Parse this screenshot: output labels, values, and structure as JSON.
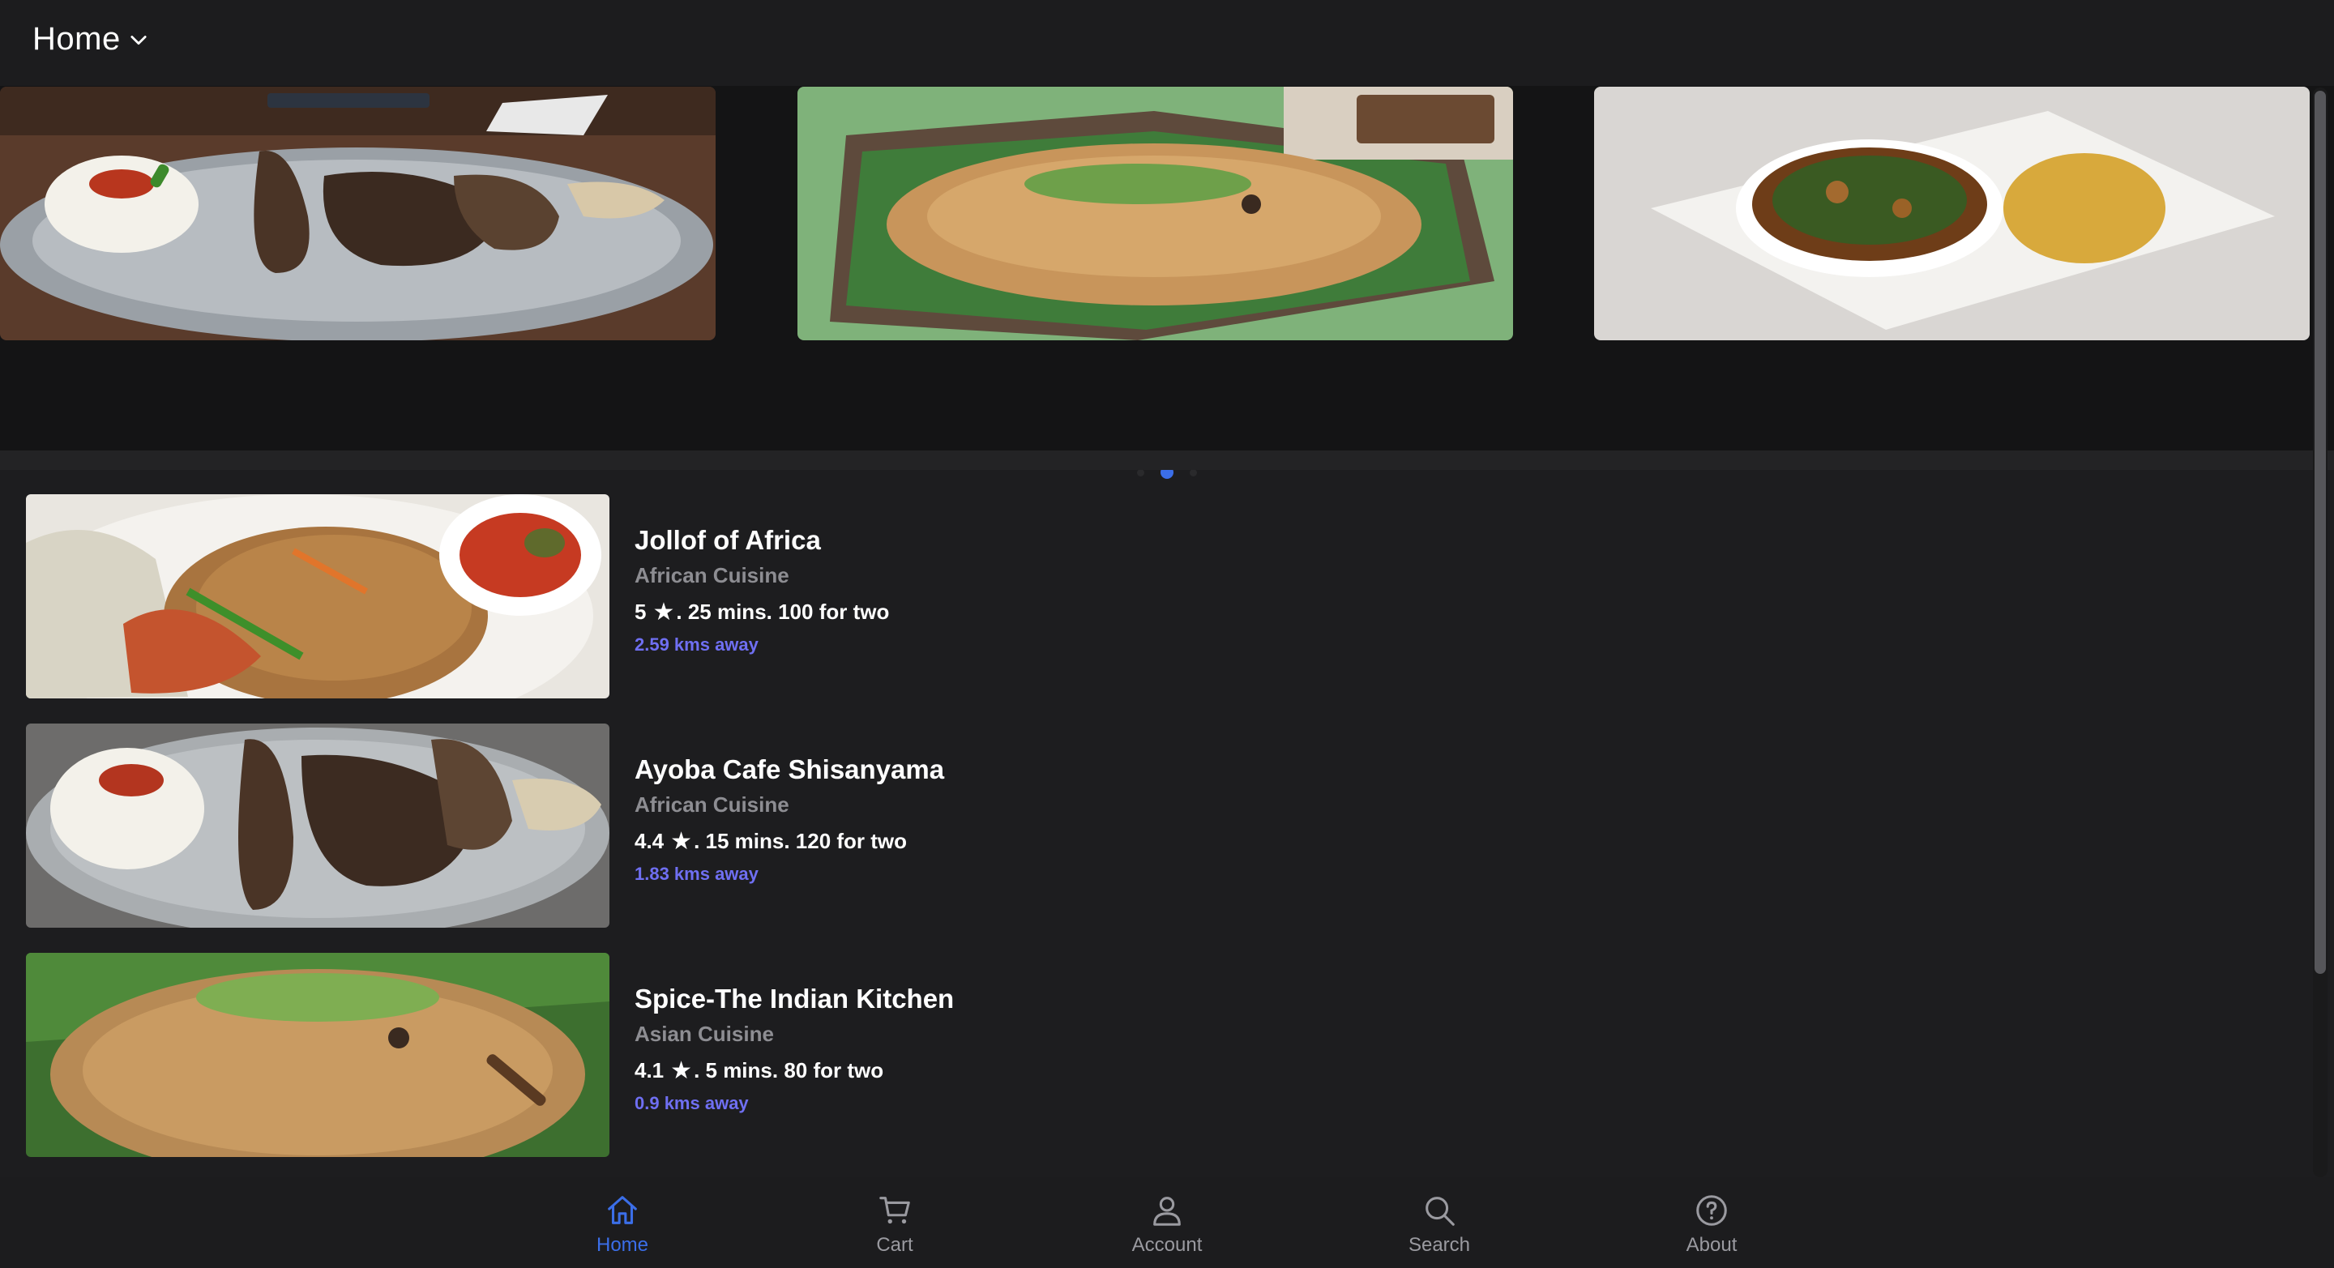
{
  "header": {
    "title": "Home"
  },
  "carousel": {
    "slides": [
      {
        "image": "grilled-meat-plate"
      },
      {
        "image": "fried-rice-banana-leaf"
      },
      {
        "image": "vegetable-soup-with-eba"
      }
    ],
    "dot_count": 3,
    "active_index": 1
  },
  "restaurants": [
    {
      "name": "Jollof of Africa",
      "cuisine": "African Cuisine",
      "rating": "5",
      "details": ". 25 mins. 100 for two",
      "distance": "2.59 kms away"
    },
    {
      "name": "Ayoba Cafe Shisanyama",
      "cuisine": "African Cuisine",
      "rating": "4.4",
      "details": ". 15 mins. 120 for two",
      "distance": "1.83 kms away"
    },
    {
      "name": "Spice-The Indian Kitchen",
      "cuisine": "Asian Cuisine",
      "rating": "4.1",
      "details": ". 5 mins. 80 for two",
      "distance": "0.9 kms away"
    }
  ],
  "tabs": [
    {
      "label": "Home",
      "icon": "home-icon",
      "active": true
    },
    {
      "label": "Cart",
      "icon": "cart-icon",
      "active": false
    },
    {
      "label": "Account",
      "icon": "account-icon",
      "active": false
    },
    {
      "label": "Search",
      "icon": "search-icon",
      "active": false
    },
    {
      "label": "About",
      "icon": "help-icon",
      "active": false
    }
  ],
  "colors": {
    "accent": "#3b6ee8",
    "distance": "#6f6ff2",
    "background": "#1d1d1f",
    "muted_text": "#8d8d92"
  }
}
